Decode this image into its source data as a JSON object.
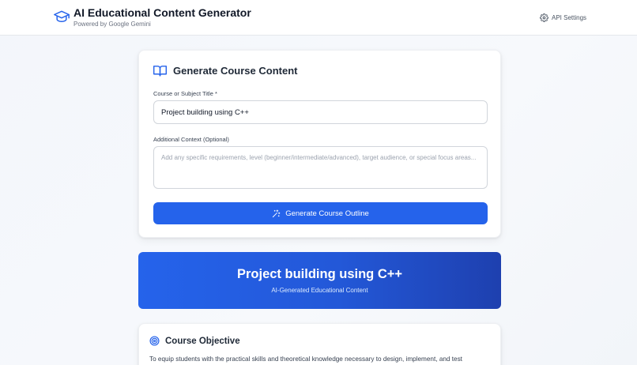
{
  "header": {
    "title": "AI Educational Content Generator",
    "subtitle": "Powered by Google Gemini",
    "logo_icon": "graduation-cap-icon",
    "settings_label": "API Settings",
    "settings_icon": "gear-icon"
  },
  "generator": {
    "title": "Generate Course Content",
    "title_icon": "open-book-icon",
    "course_label": "Course or Subject Title *",
    "course_value": "Project building using C++",
    "context_label": "Additional Context (Optional)",
    "context_value": "",
    "context_placeholder": "Add any specific requirements, level (beginner/intermediate/advanced), target audience, or special focus areas...",
    "button_label": "Generate Course Outline",
    "button_icon": "sparkles-icon"
  },
  "banner": {
    "title": "Project building using C++",
    "subtitle": "AI-Generated Educational Content"
  },
  "objective": {
    "icon": "target-icon",
    "title": "Course Objective",
    "text": "To equip students with the practical skills and theoretical knowledge necessary to design, implement, and test"
  },
  "colors": {
    "accent": "#2563eb",
    "banner_end": "#1e40af"
  }
}
